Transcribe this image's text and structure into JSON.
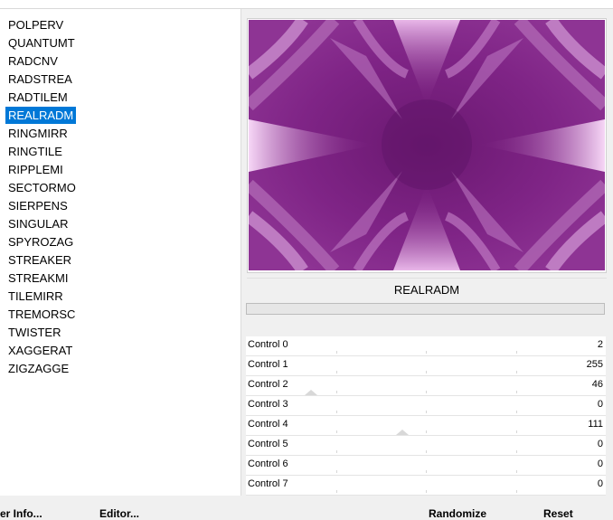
{
  "filters": {
    "items": [
      "POLPERV",
      "QUANTUMT",
      "RADCNV",
      "RADSTREA",
      "RADTILEM",
      "REALRADM",
      "RINGMIRR",
      "RINGTILE",
      "RIPPLEMI",
      "SECTORMO",
      "SIERPENS",
      "SINGULAR",
      "SPYROZAG",
      "STREAKER",
      "STREAKMI",
      "TILEMIRR",
      "TREMORSC",
      "TWISTER",
      "XAGGERAT",
      "ZIGZAGGE"
    ],
    "selected": "REALRADM"
  },
  "bottom_left": {
    "info_label": "er Info...",
    "editor_label": "Editor..."
  },
  "preview": {
    "name": "REALRADM",
    "colors": {
      "base": "#7a1e80",
      "dark": "#5e1466",
      "light": "#e8b6e8",
      "mid": "#a35aa8"
    }
  },
  "controls": [
    {
      "label": "Control 0",
      "value": "2",
      "level": 0.008
    },
    {
      "label": "Control 1",
      "value": "255",
      "level": 1.0
    },
    {
      "label": "Control 2",
      "value": "46",
      "level": 0.18
    },
    {
      "label": "Control 3",
      "value": "0",
      "level": 0
    },
    {
      "label": "Control 4",
      "value": "111",
      "level": 0.435
    },
    {
      "label": "Control 5",
      "value": "0",
      "level": 0
    },
    {
      "label": "Control 6",
      "value": "0",
      "level": 0
    },
    {
      "label": "Control 7",
      "value": "0",
      "level": 0
    }
  ],
  "actions": {
    "randomize": "Randomize",
    "reset": "Reset"
  }
}
